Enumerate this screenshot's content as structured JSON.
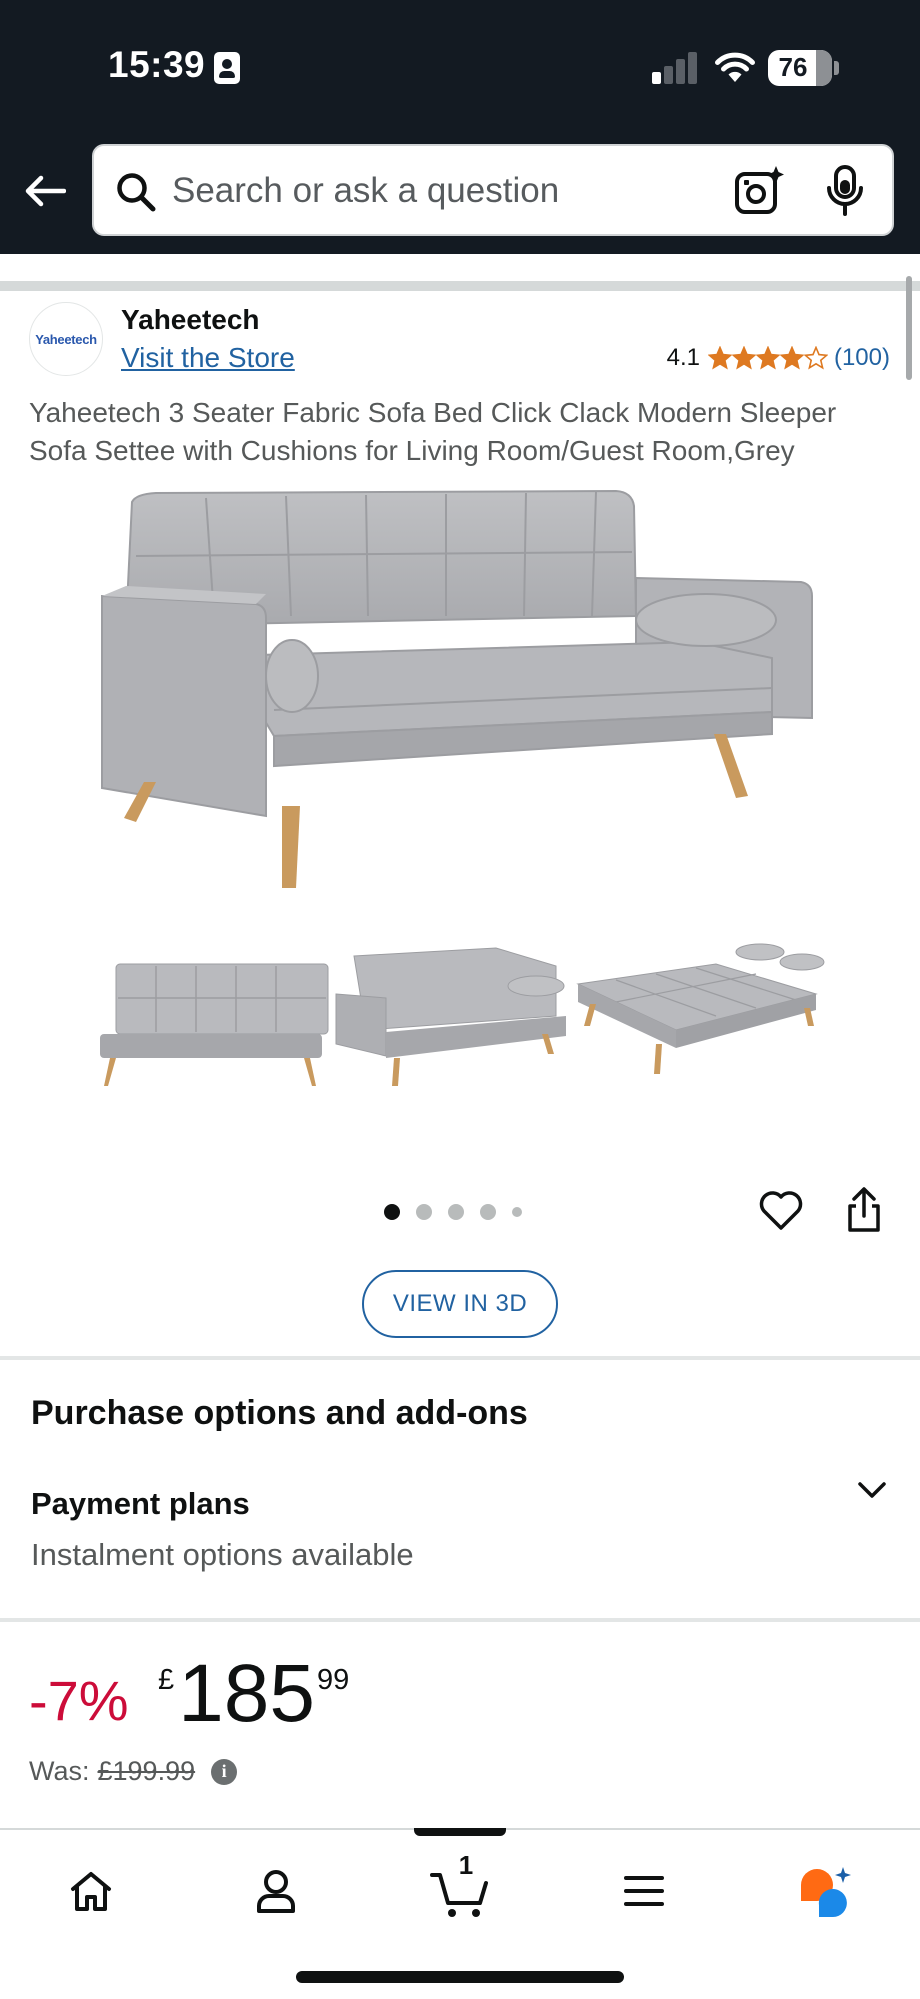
{
  "status_bar": {
    "time": "15:39",
    "battery": "76"
  },
  "search": {
    "placeholder": "Search or ask a question",
    "value": ""
  },
  "brand": {
    "name": "Yaheetech",
    "logo_text": "Yaheetech",
    "visit_store": "Visit the Store",
    "rating": "4.1",
    "stars": 4.1,
    "rating_count": "(100)"
  },
  "product": {
    "title": "Yaheetech 3 Seater Fabric Sofa Bed Click Clack Modern Sleeper Sofa Settee with Cushions for Living Room/Guest Room,Grey",
    "image_count": 5,
    "active_image": 1,
    "view_3d": "VIEW IN 3D"
  },
  "purchase_options": {
    "heading": "Purchase options and add-ons",
    "payment_title": "Payment plans",
    "payment_subtitle": "Instalment options available"
  },
  "price": {
    "discount": "-7%",
    "currency": "£",
    "whole": "185",
    "fraction": "99",
    "was_label": "Was:",
    "was_price": "£199.99"
  },
  "bottom_nav": {
    "cart_count": "1",
    "items": [
      "home",
      "account",
      "cart",
      "menu",
      "rufus"
    ]
  },
  "colors": {
    "header": "#131a22",
    "link": "#2162a1",
    "star": "#de7921",
    "discount": "#cc0c39"
  }
}
